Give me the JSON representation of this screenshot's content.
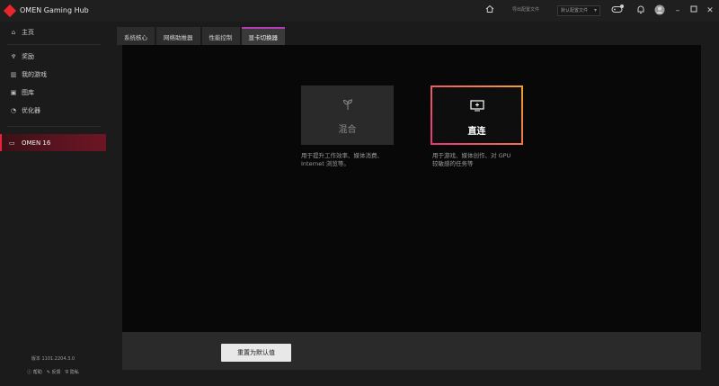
{
  "app": {
    "title": "OMEN Gaming Hub"
  },
  "titlebar": {
    "profile_label": "导出配置文件",
    "profile_select": "默认配置文件",
    "icons": [
      "home-icon",
      "gamepad-icon",
      "bell-icon",
      "avatar",
      "minimize-icon",
      "maximize-icon",
      "close-icon"
    ],
    "controller_badge": "1"
  },
  "sidebar": {
    "items": [
      {
        "label": "主页",
        "icon": "home-icon"
      },
      {
        "label": "奖励",
        "icon": "trophy-icon"
      },
      {
        "label": "我的游戏",
        "icon": "library-icon"
      },
      {
        "label": "图库",
        "icon": "gallery-icon"
      },
      {
        "label": "优化器",
        "icon": "optimizer-icon"
      }
    ],
    "device": {
      "label": "OMEN 16",
      "icon": "laptop-icon"
    },
    "version": "版本 1101.2204.3.0",
    "footer": [
      {
        "label": "帮助",
        "icon": "help-icon"
      },
      {
        "label": "反馈",
        "icon": "feedback-icon"
      },
      {
        "label": "隐私",
        "icon": "privacy-icon"
      }
    ]
  },
  "tabs": [
    {
      "label": "系统核心",
      "active": false
    },
    {
      "label": "网络助推器",
      "active": false
    },
    {
      "label": "性能控制",
      "active": false
    },
    {
      "label": "显卡切换器",
      "active": true
    }
  ],
  "gpu_modes": {
    "hybrid": {
      "label": "混合",
      "icon": "sprout-icon",
      "desc_line1": "用于提升工作效率、媒体消费、",
      "desc_line2": "Internet 浏览等。"
    },
    "direct": {
      "label": "直连",
      "icon": "monitor-icon",
      "selected": true,
      "desc_line1": "用于游戏、媒体创作、对 GPU",
      "desc_line2": "较敏感的任务等"
    }
  },
  "actions": {
    "reset_label": "重置为默认值"
  },
  "colors": {
    "accent": "#e0263a",
    "tab_accent": "#b43cb7",
    "selected_border_start": "#e9327f",
    "selected_border_end": "#f0a030"
  }
}
